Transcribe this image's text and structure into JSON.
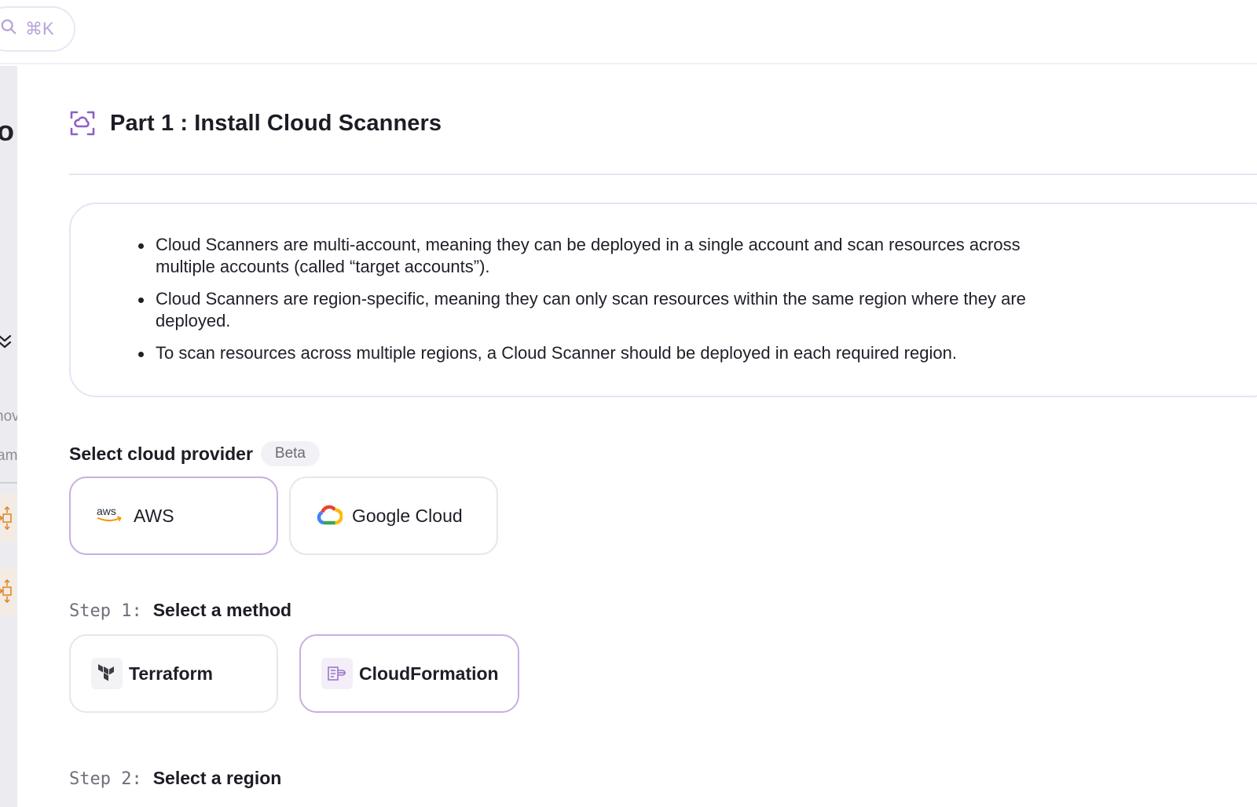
{
  "search": {
    "shortcut": "⌘K",
    "icon": "search-icon"
  },
  "sidebar": {
    "letter": "o",
    "text1": "nov",
    "text2": "am"
  },
  "part": {
    "title": "Part 1 : Install Cloud Scanners",
    "icon": "cloud-scan-icon"
  },
  "info": {
    "bullets": [
      "Cloud Scanners are multi-account, meaning they can be deployed in a single account and scan resources across multiple accounts (called “target accounts”).",
      "Cloud Scanners are region-specific, meaning they can only scan resources within the same region where they are deployed.",
      "To scan resources across multiple regions, a Cloud Scanner should be deployed in each required region."
    ]
  },
  "provider": {
    "label": "Select cloud provider",
    "badge": "Beta",
    "options": [
      {
        "label": "AWS",
        "icon": "aws-logo-icon",
        "selected": true
      },
      {
        "label": "Google Cloud",
        "icon": "google-cloud-logo-icon",
        "selected": false
      }
    ]
  },
  "step1": {
    "num": "Step 1:",
    "title": "Select a method",
    "options": [
      {
        "label": "Terraform",
        "icon": "terraform-icon",
        "selected": false
      },
      {
        "label": "CloudFormation",
        "icon": "cloudformation-icon",
        "selected": true
      }
    ]
  },
  "step2": {
    "num": "Step 2:",
    "title": "Select a region"
  },
  "colors": {
    "accent": "#8f5fc4",
    "selected_border": "#c7afe3",
    "orange_icon": "#e0892f"
  }
}
